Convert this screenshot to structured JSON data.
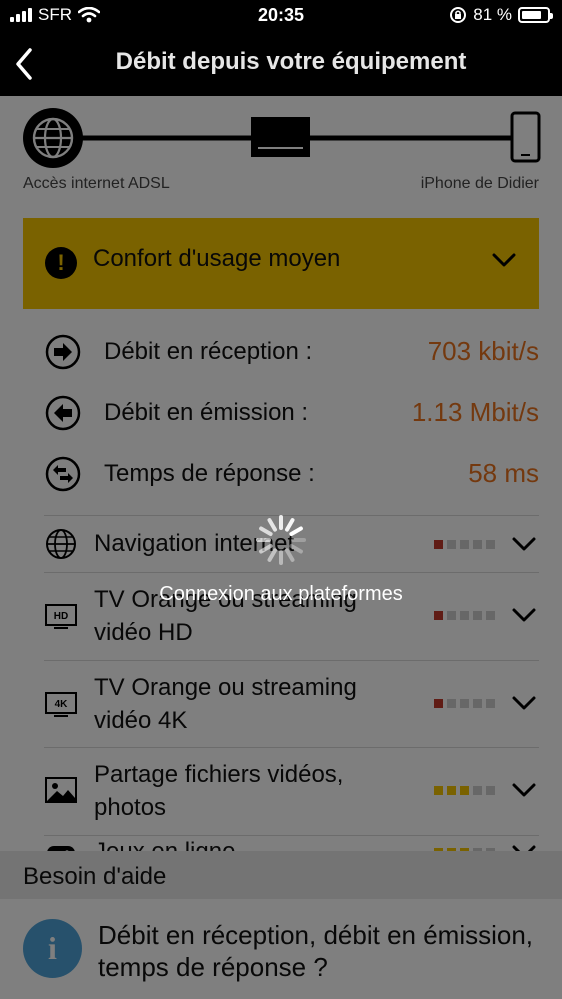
{
  "status_bar": {
    "carrier": "SFR",
    "time": "20:35",
    "battery_percent": "81 %",
    "battery_level": 0.81
  },
  "header": {
    "back_icon": "chevron-left-icon",
    "title": "Débit depuis votre équipement"
  },
  "topology": {
    "left_label": "Accès internet ADSL",
    "right_label": "iPhone de Didier",
    "left_icon": "globe-icon",
    "middle_icon": "box-icon",
    "right_icon": "phone-icon"
  },
  "alert": {
    "icon": "exclamation-icon",
    "text": "Confort d'usage moyen",
    "color": "#f5c400"
  },
  "metrics": [
    {
      "icon": "arrow-right-circle-icon",
      "label": "Débit en réception :",
      "value": "703 kbit/s"
    },
    {
      "icon": "arrow-left-circle-icon",
      "label": "Débit en émission :",
      "value": "1.13 Mbit/s"
    },
    {
      "icon": "exchange-circle-icon",
      "label": "Temps de réponse :",
      "value": "58 ms"
    }
  ],
  "metric_value_color": "#e8731e",
  "usages": [
    {
      "icon": "globe-icon",
      "label": "Navigation internet",
      "level": 1,
      "level_color": "#c0392b"
    },
    {
      "icon": "tv-hd-icon",
      "label": "TV Orange ou streaming vidéo HD",
      "level": 1,
      "level_color": "#c0392b"
    },
    {
      "icon": "tv-4k-icon",
      "label": "TV Orange ou streaming vidéo 4K",
      "level": 1,
      "level_color": "#c0392b"
    },
    {
      "icon": "image-icon",
      "label": "Partage fichiers vidéos, photos",
      "level": 3,
      "level_color": "#f5c400"
    },
    {
      "icon": "gamepad-icon",
      "label": "Jeux en ligne",
      "level": 3,
      "level_color": "#f5c400"
    }
  ],
  "help": {
    "heading": "Besoin d'aide",
    "icon": "info-icon",
    "text": "Débit en réception, débit en émission, temps de réponse ?"
  },
  "loading": {
    "text": "Connexion aux plateformes"
  }
}
